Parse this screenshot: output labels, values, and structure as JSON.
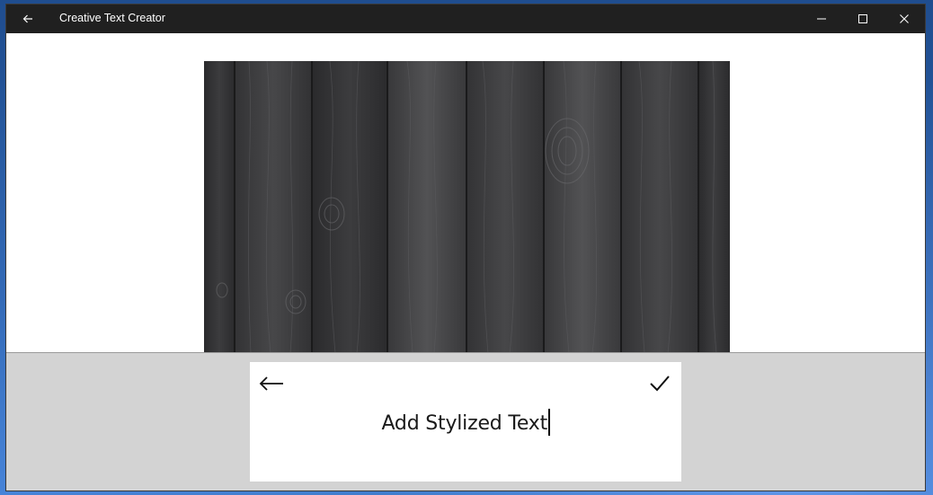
{
  "window": {
    "title": "Creative Text Creator"
  },
  "titlebar": {
    "back_icon": "arrow-left-icon",
    "minimize_icon": "minimize-icon",
    "maximize_icon": "maximize-icon",
    "close_icon": "close-icon"
  },
  "canvas": {
    "image": "dark-wood-planks"
  },
  "editor": {
    "back_icon": "arrow-left-icon",
    "confirm_icon": "checkmark-icon",
    "text_value": "Add Stylized Text"
  },
  "colors": {
    "titlebar_bg": "#202020",
    "panel_bg": "#d3d3d3",
    "editor_bg": "#ffffff",
    "wood_dark": "#2e2e30"
  }
}
